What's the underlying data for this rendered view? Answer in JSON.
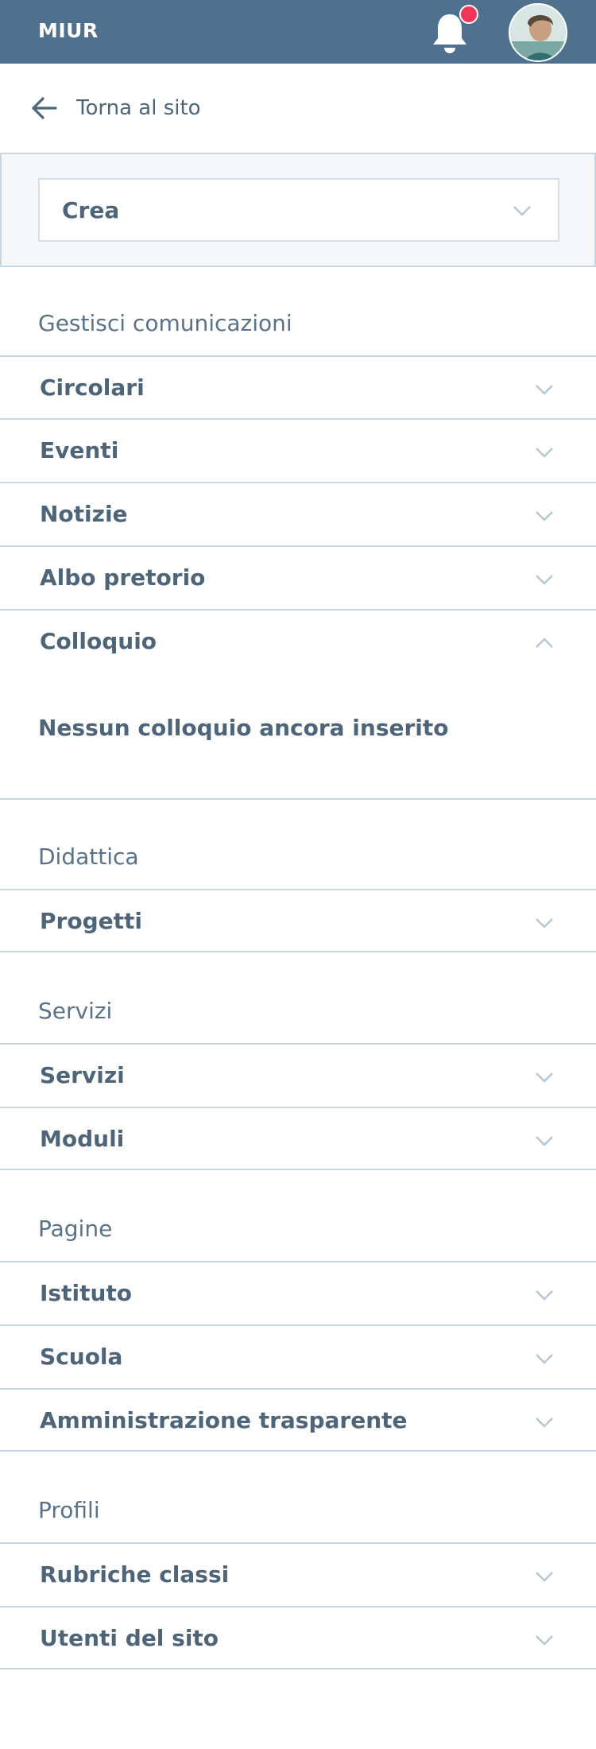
{
  "header": {
    "brand": "MIUR",
    "notification_dot_color": "#f0365b",
    "bar_color": "#50718d"
  },
  "back_link": {
    "label": "Torna al sito"
  },
  "crea": {
    "label": "Crea"
  },
  "sections": {
    "gestisci": {
      "title": "Gestisci comunicazioni",
      "items": [
        "Circolari",
        "Eventi",
        "Notizie",
        "Albo pretorio",
        "Colloquio"
      ],
      "colloquio_empty": "Nessun colloquio ancora inserito"
    },
    "didattica": {
      "title": "Didattica",
      "items": [
        "Progetti"
      ]
    },
    "servizi": {
      "title": "Servizi",
      "items": [
        "Servizi",
        "Moduli"
      ]
    },
    "pagine": {
      "title": "Pagine",
      "items": [
        "Istituto",
        "Scuola",
        "Amministrazione trasparente"
      ]
    },
    "profili": {
      "title": "Profili",
      "items": [
        "Rubriche classi",
        "Utenti del sito"
      ]
    }
  }
}
